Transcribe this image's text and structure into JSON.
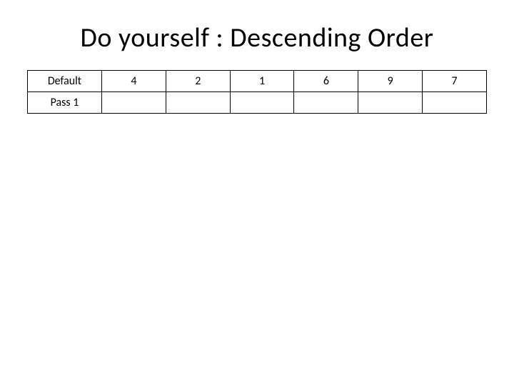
{
  "title": "Do yourself : Descending Order",
  "table": {
    "rows": [
      {
        "label": "Default",
        "cells": [
          "4",
          "2",
          "1",
          "6",
          "9",
          "7"
        ]
      },
      {
        "label": "Pass 1",
        "cells": [
          "",
          "",
          "",
          "",
          "",
          ""
        ]
      }
    ]
  },
  "chart_data": {
    "type": "table",
    "title": "Do yourself : Descending Order",
    "columns": [
      "",
      "c1",
      "c2",
      "c3",
      "c4",
      "c5",
      "c6"
    ],
    "rows": [
      [
        "Default",
        4,
        2,
        1,
        6,
        9,
        7
      ],
      [
        "Pass 1",
        null,
        null,
        null,
        null,
        null,
        null
      ]
    ]
  }
}
